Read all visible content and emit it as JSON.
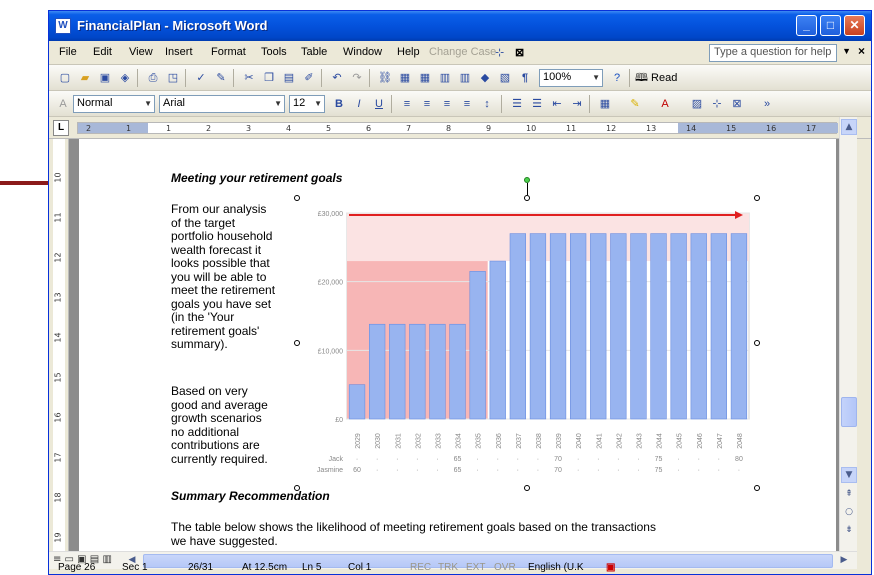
{
  "window": {
    "title": "FinancialPlan - Microsoft Word",
    "icon": "word-doc-icon"
  },
  "menu": {
    "items": [
      "File",
      "Edit",
      "View",
      "Insert",
      "Format",
      "Tools",
      "Table",
      "Window",
      "Help"
    ],
    "change_case": "Change Case",
    "help_placeholder": "Type a question for help"
  },
  "standard_toolbar": {
    "zoom": "100%",
    "read": "Read"
  },
  "formatting_toolbar": {
    "style": "Normal",
    "font": "Arial",
    "size": "12"
  },
  "ruler": {
    "h_numbers": [
      "2",
      "1",
      "1",
      "2",
      "3",
      "4",
      "5",
      "6",
      "7",
      "8",
      "9",
      "10",
      "11",
      "12",
      "13",
      "14",
      "15",
      "16",
      "17"
    ],
    "v_numbers": [
      "10",
      "11",
      "12",
      "13",
      "14",
      "15",
      "16",
      "17",
      "18",
      "19"
    ]
  },
  "document": {
    "heading1": "Meeting your retirement goals",
    "para1": "From our analysis\nof the target\nportfolio household\nwealth forecast it\nlooks possible that\nyou will be able to\nmeet the retirement\ngoals you have set\n(in the 'Your\nretirement goals'\nsummary).",
    "para2": "Based on very\ngood and average\ngrowth scenarios\nno additional\ncontributions are\ncurrently required.",
    "heading2": "Summary Recommendation",
    "para3": "The table below shows the likelihood of meeting retirement goals based on the transactions\nwe have suggested."
  },
  "status": {
    "page": "Page 26",
    "sec": "Sec 1",
    "pages": "26/31",
    "at": "At 12.5cm",
    "ln": "Ln 5",
    "col": "Col 1",
    "rec": "REC",
    "trk": "TRK",
    "ext": "EXT",
    "ovr": "OVR",
    "lang": "English (U.K"
  },
  "colors": {
    "bar_fill": "#98b4f0",
    "bar_edge": "#6a8de0",
    "shortfall": "#f7b6b6",
    "target_band": "#fbe3e3",
    "target_line": "#e02020",
    "arrow": "#8b1a1a"
  },
  "chart_data": {
    "type": "bar",
    "categories": [
      "2029",
      "2030",
      "2031",
      "2032",
      "2033",
      "2034",
      "2035",
      "2036",
      "2037",
      "2038",
      "2039",
      "2040",
      "2041",
      "2042",
      "2043",
      "2044",
      "2045",
      "2046",
      "2047",
      "2048"
    ],
    "values": [
      5000,
      13800,
      13800,
      13800,
      13800,
      13800,
      21500,
      23000,
      27000,
      27000,
      27000,
      27000,
      27000,
      27000,
      27000,
      27000,
      27000,
      27000,
      27000,
      27000
    ],
    "target": 30000,
    "shortfall_level": 23000,
    "ylim": [
      0,
      30000
    ],
    "yticks": [
      "£30,000",
      "£20,000",
      "£10,000",
      "£0"
    ],
    "ages": {
      "rows": [
        {
          "name": "Jack",
          "labels": {
            "2034": "65",
            "2039": "70",
            "2044": "75",
            "2048": "80"
          }
        },
        {
          "name": "Jasmine",
          "labels": {
            "2029": "60",
            "2034": "65",
            "2039": "70",
            "2044": "75"
          }
        }
      ]
    }
  }
}
